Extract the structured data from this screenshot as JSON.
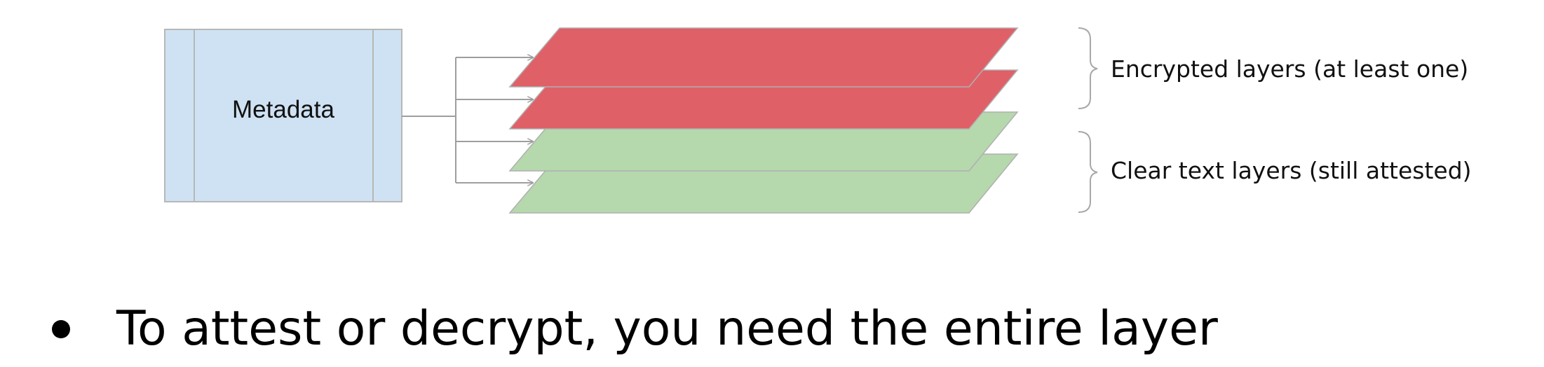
{
  "diagram": {
    "metadata_box": {
      "label": "Metadata",
      "fill": "#cfe2f3",
      "stroke": "#b7b7b7"
    },
    "layers": [
      {
        "kind": "encrypted",
        "fill": "#e06068"
      },
      {
        "kind": "encrypted",
        "fill": "#e06068"
      },
      {
        "kind": "clear",
        "fill": "#b5d8ad"
      },
      {
        "kind": "clear",
        "fill": "#b5d8ad"
      }
    ],
    "braces": [
      {
        "label": "Encrypted layers (at least one)"
      },
      {
        "label": "Clear text layers (still attested)"
      }
    ],
    "connector_color": "#9e9e9e"
  },
  "bullets": [
    {
      "text": "To attest or decrypt, you need the entire layer"
    }
  ]
}
